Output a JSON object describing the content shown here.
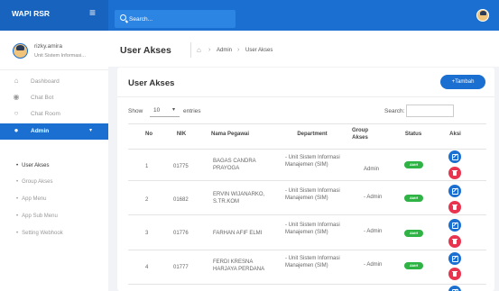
{
  "app": {
    "brand": "WAPI RSR"
  },
  "search": {
    "placeholder": "Search..."
  },
  "user": {
    "name": "rizky.amira",
    "role": "Unit Sistem Informasi..."
  },
  "sidebar": {
    "items": [
      {
        "label": "Dashboard",
        "icon": "home-icon"
      },
      {
        "label": "Chat Bot",
        "icon": "robot-icon"
      },
      {
        "label": "Chat Room",
        "icon": "chat-icon"
      },
      {
        "label": "Admin",
        "icon": "users-icon"
      }
    ],
    "submenu": [
      "User Akses",
      "Group Akses",
      "App Menu",
      "App Sub Menu",
      "Setting Webhook"
    ]
  },
  "header": {
    "title": "User Akses",
    "breadcrumb": [
      "Admin",
      "User Akses"
    ]
  },
  "card": {
    "title": "User Akses",
    "add_label": "+Tambah",
    "show_label": "Show",
    "entries_value": "10",
    "entries_label": "entries",
    "search_label": "Search:"
  },
  "table": {
    "headers": [
      "No",
      "NIK",
      "Nama Pegawai",
      "Department",
      "Group Akses",
      "Status",
      "Aksi"
    ],
    "rows": [
      {
        "no": "1",
        "nik": "01775",
        "nama": "BAGAS CANDRA PRAYOGA",
        "dept": "- Unit Sistem Informasi Manajemen (SIM)",
        "group": "Admin",
        "status": "Aktif"
      },
      {
        "no": "2",
        "nik": "01682",
        "nama": "ERVIN WIJANARKO, S.TR.KOM",
        "dept": "- Unit Sistem Informasi Manajemen (SIM)",
        "group": "- Admin",
        "status": "Aktif"
      },
      {
        "no": "3",
        "nik": "01776",
        "nama": "FARHAN AFIF ELMI",
        "dept": "- Unit Sistem Informasi Manajemen (SIM)",
        "group": "- Admin",
        "status": "Aktif"
      },
      {
        "no": "4",
        "nik": "01777",
        "nama": "FERDI KRESNA HARJAYA PERDANA",
        "dept": "- Unit Sistem Informasi Manajemen (SIM)",
        "group": "- Admin",
        "status": "Aktif"
      }
    ]
  },
  "colors": {
    "primary": "#1a6fd0",
    "success": "#2fb344",
    "danger": "#e8344e"
  }
}
